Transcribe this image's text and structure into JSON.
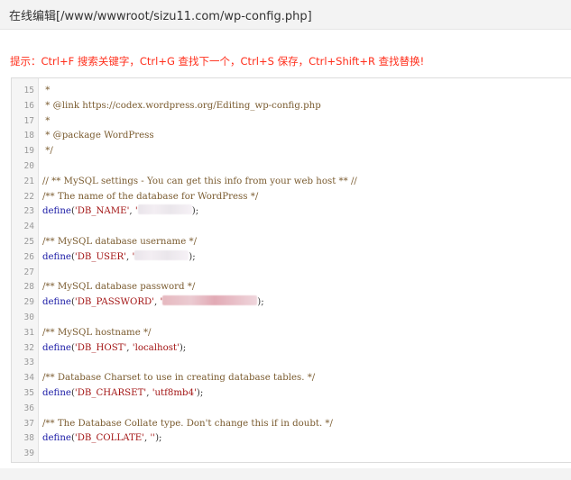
{
  "window": {
    "title": "在线编辑[/www/wwwroot/sizu11.com/wp-config.php]"
  },
  "hint": "提示：Ctrl+F 搜索关键字，Ctrl+G 查找下一个，Ctrl+S 保存，Ctrl+Shift+R 查找替换!",
  "editor": {
    "lines": [
      {
        "num": "15",
        "parts": [
          {
            "t": " *",
            "c": "comment"
          }
        ]
      },
      {
        "num": "16",
        "parts": [
          {
            "t": " * @link https://codex.wordpress.org/Editing_wp-config.php",
            "c": "comment"
          }
        ]
      },
      {
        "num": "17",
        "parts": [
          {
            "t": " *",
            "c": "comment"
          }
        ]
      },
      {
        "num": "18",
        "parts": [
          {
            "t": " * @package WordPress",
            "c": "comment"
          }
        ]
      },
      {
        "num": "19",
        "parts": [
          {
            "t": " */",
            "c": "comment"
          }
        ]
      },
      {
        "num": "20",
        "parts": []
      },
      {
        "num": "21",
        "parts": [
          {
            "t": "// ** MySQL settings - You can get this info from your web host ** //",
            "c": "comment"
          }
        ]
      },
      {
        "num": "22",
        "parts": [
          {
            "t": "/** The name of the database for WordPress */",
            "c": "comment"
          }
        ]
      },
      {
        "num": "23",
        "parts": [
          {
            "t": "define",
            "c": "key"
          },
          {
            "t": "(",
            "c": "plain"
          },
          {
            "t": "'DB_NAME'",
            "c": "str"
          },
          {
            "t": ", ",
            "c": "plain"
          },
          {
            "t": "'",
            "c": "str"
          },
          {
            "t": "",
            "c": "blur"
          },
          {
            "t": ");",
            "c": "plain"
          }
        ]
      },
      {
        "num": "24",
        "parts": []
      },
      {
        "num": "25",
        "parts": [
          {
            "t": "/** MySQL database username */",
            "c": "comment"
          }
        ]
      },
      {
        "num": "26",
        "parts": [
          {
            "t": "define",
            "c": "key"
          },
          {
            "t": "(",
            "c": "plain"
          },
          {
            "t": "'DB_USER'",
            "c": "str"
          },
          {
            "t": ", ",
            "c": "plain"
          },
          {
            "t": "'",
            "c": "str"
          },
          {
            "t": "",
            "c": "blur"
          },
          {
            "t": ");",
            "c": "plain"
          }
        ]
      },
      {
        "num": "27",
        "parts": []
      },
      {
        "num": "28",
        "parts": [
          {
            "t": "/** MySQL database password */",
            "c": "comment"
          }
        ]
      },
      {
        "num": "29",
        "parts": [
          {
            "t": "define",
            "c": "key"
          },
          {
            "t": "(",
            "c": "plain"
          },
          {
            "t": "'DB_PASSWORD'",
            "c": "str"
          },
          {
            "t": ", ",
            "c": "plain"
          },
          {
            "t": "'",
            "c": "str"
          },
          {
            "t": "",
            "c": "blurpw"
          },
          {
            "t": ");",
            "c": "plain"
          }
        ]
      },
      {
        "num": "30",
        "parts": []
      },
      {
        "num": "31",
        "parts": [
          {
            "t": "/** MySQL hostname */",
            "c": "comment"
          }
        ]
      },
      {
        "num": "32",
        "parts": [
          {
            "t": "define",
            "c": "key"
          },
          {
            "t": "(",
            "c": "plain"
          },
          {
            "t": "'DB_HOST'",
            "c": "str"
          },
          {
            "t": ", ",
            "c": "plain"
          },
          {
            "t": "'localhost'",
            "c": "str"
          },
          {
            "t": ");",
            "c": "plain"
          }
        ]
      },
      {
        "num": "33",
        "parts": []
      },
      {
        "num": "34",
        "parts": [
          {
            "t": "/** Database Charset to use in creating database tables. */",
            "c": "comment"
          }
        ]
      },
      {
        "num": "35",
        "parts": [
          {
            "t": "define",
            "c": "key"
          },
          {
            "t": "(",
            "c": "plain"
          },
          {
            "t": "'DB_CHARSET'",
            "c": "str"
          },
          {
            "t": ", ",
            "c": "plain"
          },
          {
            "t": "'utf8mb4'",
            "c": "str"
          },
          {
            "t": ");",
            "c": "plain"
          }
        ]
      },
      {
        "num": "36",
        "parts": []
      },
      {
        "num": "37",
        "parts": [
          {
            "t": "/** The Database Collate type. Don't change this if in doubt. */",
            "c": "comment"
          }
        ]
      },
      {
        "num": "38",
        "parts": [
          {
            "t": "define",
            "c": "key"
          },
          {
            "t": "(",
            "c": "plain"
          },
          {
            "t": "'DB_COLLATE'",
            "c": "str"
          },
          {
            "t": ", ",
            "c": "plain"
          },
          {
            "t": "''",
            "c": "str"
          },
          {
            "t": ");",
            "c": "plain"
          }
        ]
      },
      {
        "num": "39",
        "parts": []
      }
    ]
  },
  "colors": {
    "hint": "#ff2d1a",
    "comment": "#7a5b2f",
    "keyword": "#1a1aa6",
    "string": "#a31515",
    "line_number": "#999999"
  }
}
